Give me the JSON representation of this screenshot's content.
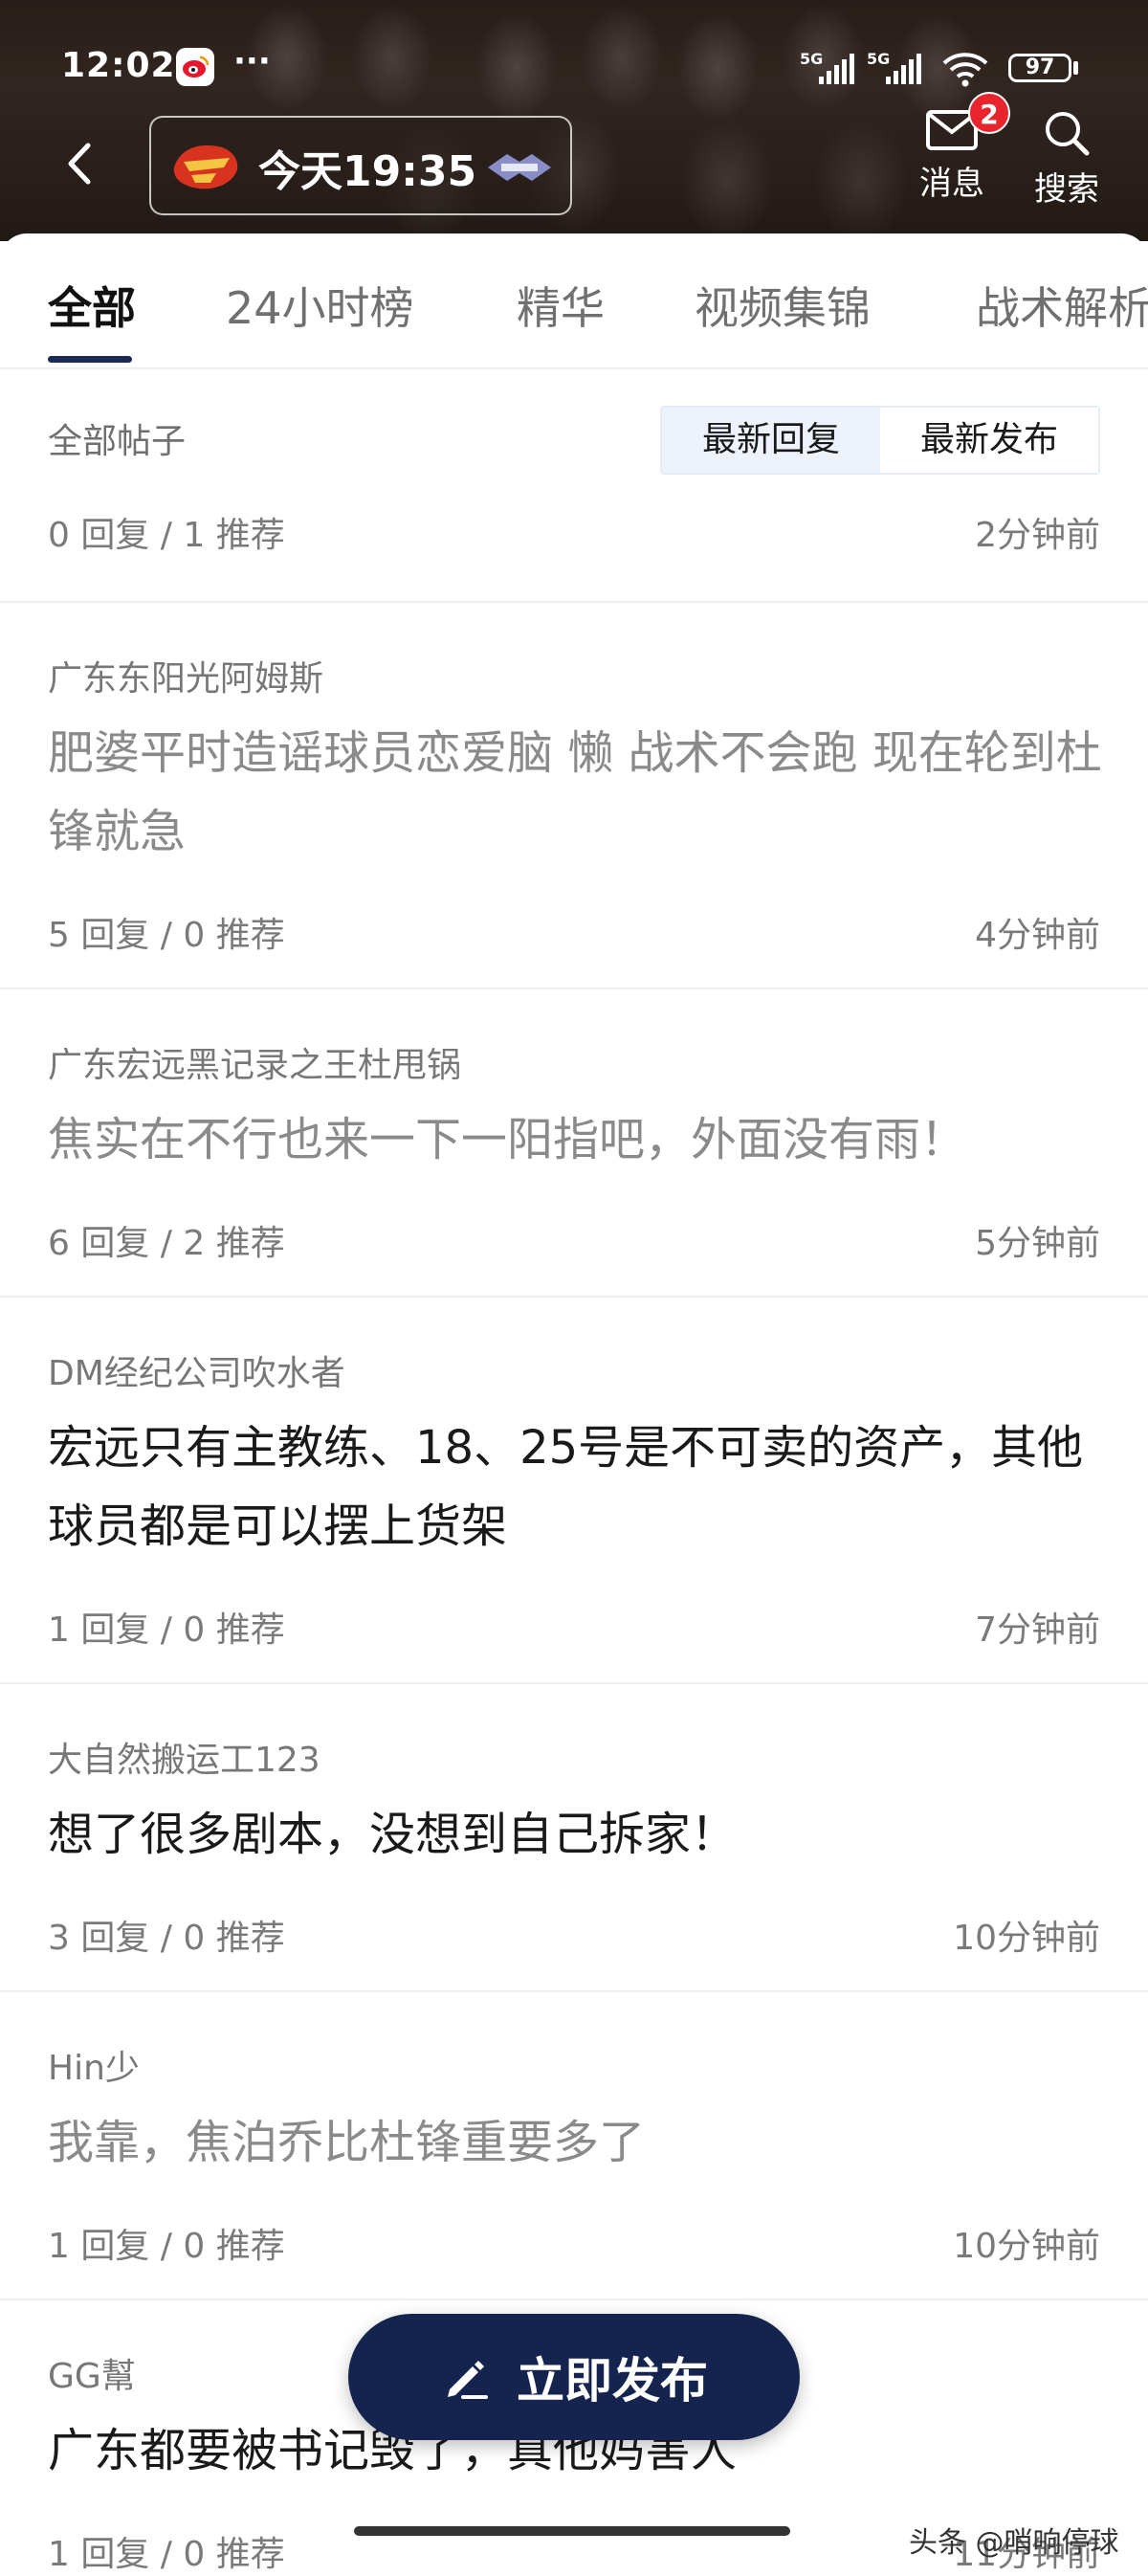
{
  "status_bar": {
    "time": "12:02",
    "more": "···",
    "signal_1": "5G",
    "signal_2": "5G",
    "battery": "97"
  },
  "header": {
    "game_time": "今天19:35",
    "messages_label": "消息",
    "messages_badge": "2",
    "search_label": "搜索"
  },
  "tabs": [
    {
      "label": "全部",
      "active": true
    },
    {
      "label": "24小时榜",
      "active": false
    },
    {
      "label": "精华",
      "active": false
    },
    {
      "label": "视频集锦",
      "active": false
    },
    {
      "label": "战术解析",
      "active": false
    }
  ],
  "filter": {
    "section_label": "全部帖子",
    "sort_latest_reply": "最新回复",
    "sort_latest_post": "最新发布",
    "first_stats": "0 回复 / 1 推荐",
    "first_time": "2分钟前"
  },
  "posts": [
    {
      "author": "广东东阳光阿姆斯",
      "title": "肥婆平时造谣球员恋爱脑 懒 战术不会跑  现在轮到杜锋就急",
      "stats": "5 回复 / 0 推荐",
      "time": "4分钟前",
      "read": true
    },
    {
      "author": "广东宏远黑记录之王杜甩锅",
      "title": "焦实在不行也来一下一阳指吧，外面没有雨！",
      "stats": "6 回复 / 2 推荐",
      "time": "5分钟前",
      "read": true
    },
    {
      "author": "DM经纪公司吹水者",
      "title": "宏远只有主教练、18、25号是不可卖的资产，其他球员都是可以摆上货架",
      "stats": "1 回复 / 0 推荐",
      "time": "7分钟前",
      "read": false
    },
    {
      "author": "大自然搬运工123",
      "title": "想了很多剧本，没想到自己拆家！",
      "stats": "3 回复 / 0 推荐",
      "time": "10分钟前",
      "read": false
    },
    {
      "author": "Hin少",
      "title": "我靠，焦泊乔比杜锋重要多了",
      "stats": "1 回复 / 0 推荐",
      "time": "10分钟前",
      "read": true
    },
    {
      "author": "GG幫",
      "title": "广东都要被书记毁了，真他妈害人",
      "stats": "1 回复 / 0 推荐",
      "time": "11分钟前",
      "read": false
    }
  ],
  "fab": {
    "label": "立即发布"
  },
  "watermark": "头条 @哨响停球",
  "colors": {
    "accent": "#14244e",
    "badge": "#e8242d",
    "muted": "#7a7a7a"
  }
}
